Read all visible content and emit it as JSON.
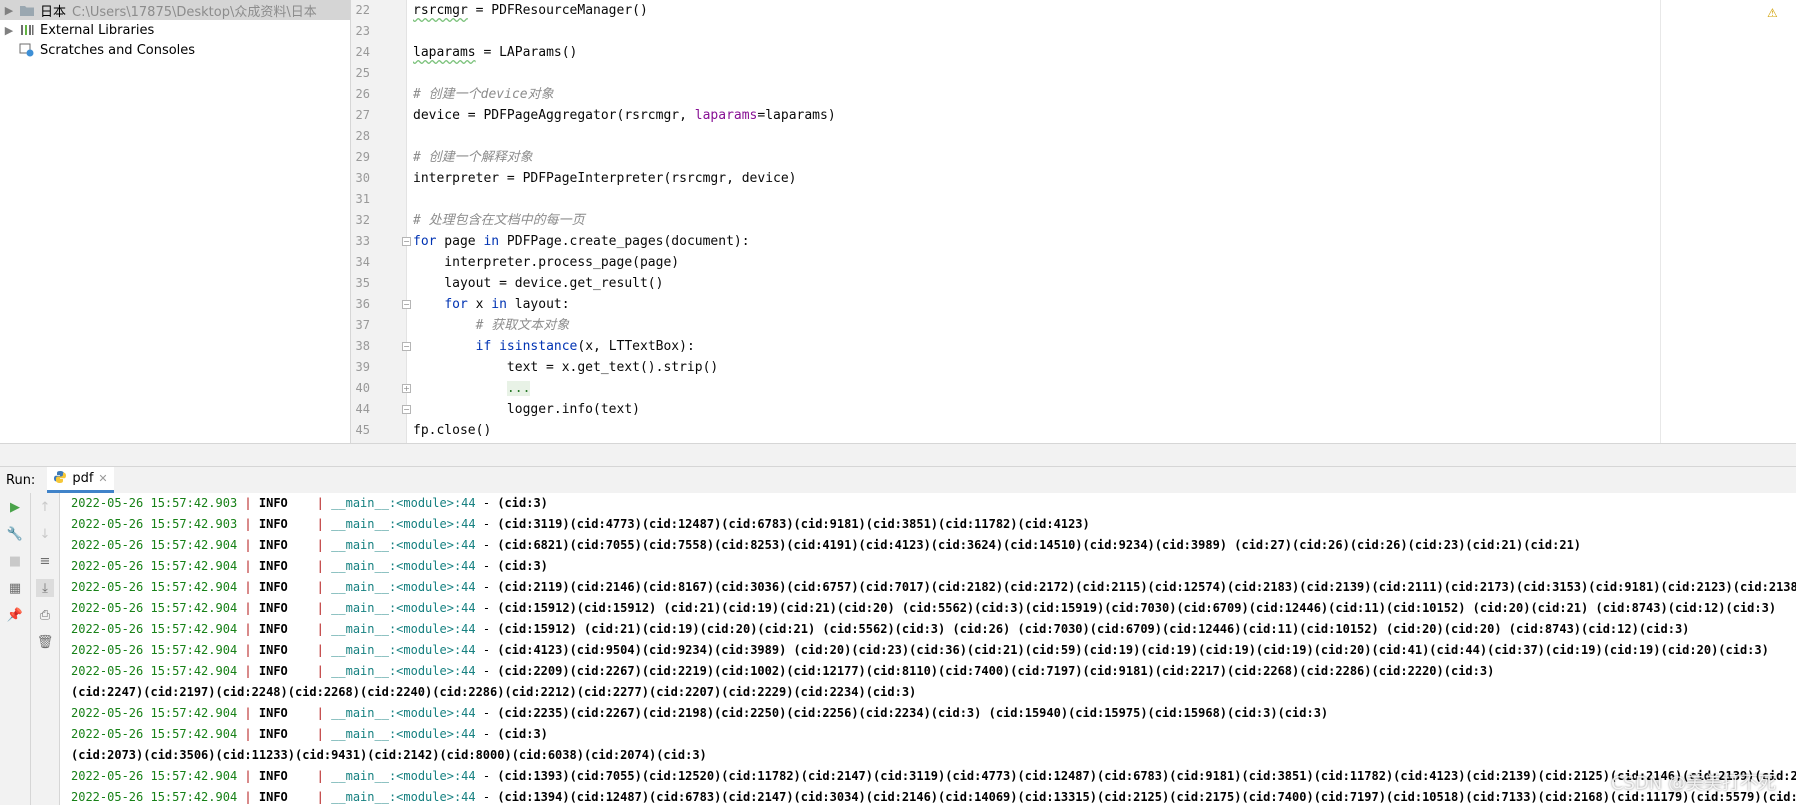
{
  "project_tree": [
    {
      "name": "日本",
      "path": "C:\\Users\\17875\\Desktop\\众成资料\\日本",
      "selected": true,
      "icon": "folder-icon"
    },
    {
      "name": "External Libraries",
      "path": "",
      "selected": false,
      "icon": "libraries-icon"
    },
    {
      "name": "Scratches and Consoles",
      "path": "",
      "selected": false,
      "icon": "scratches-icon"
    }
  ],
  "editor": {
    "line_numbers": [
      "22",
      "23",
      "24",
      "25",
      "26",
      "27",
      "28",
      "29",
      "30",
      "31",
      "32",
      "33",
      "34",
      "35",
      "36",
      "37",
      "38",
      "39",
      "40",
      "44",
      "45"
    ],
    "lines": [
      "rsrcmgr = PDFResourceManager()",
      "",
      "laparams = LAParams()",
      "",
      "# 创建一个device对象",
      "device = PDFPageAggregator(rsrcmgr, laparams=laparams)",
      "",
      "# 创建一个解释对象",
      "interpreter = PDFPageInterpreter(rsrcmgr, device)",
      "",
      "# 处理包含在文档中的每一页",
      "for page in PDFPage.create_pages(document):",
      "    interpreter.process_page(page)",
      "    layout = device.get_result()",
      "    for x in layout:",
      "        # 获取文本对象",
      "        if isinstance(x, LTTextBox):",
      "            text = x.get_text().strip()",
      "            ...",
      "            logger.info(text)",
      "fp.close()"
    ],
    "warning_icon": "warning-icon"
  },
  "run_panel": {
    "label": "Run:",
    "tab_name": "pdf",
    "toolbar": [
      "run-icon",
      "up-icon",
      "wrench-icon",
      "down-icon",
      "stop-icon",
      "soft-wrap-icon",
      "layout-icon",
      "scroll-end-icon",
      "pin-icon",
      "print-icon",
      "trash-icon"
    ]
  },
  "console": [
    {
      "ts": "2022-05-26 15:57:42.903",
      "level": "INFO",
      "module": "__main__:<module>:44",
      "msg": "(cid:3)"
    },
    {
      "ts": "2022-05-26 15:57:42.903",
      "level": "INFO",
      "module": "__main__:<module>:44",
      "msg": "(cid:3119)(cid:4773)(cid:12487)(cid:6783)(cid:9181)(cid:3851)(cid:11782)(cid:4123)"
    },
    {
      "ts": "2022-05-26 15:57:42.904",
      "level": "INFO",
      "module": "__main__:<module>:44",
      "msg": "(cid:6821)(cid:7055)(cid:7558)(cid:8253)(cid:4191)(cid:4123)(cid:3624)(cid:14510)(cid:9234)(cid:3989) (cid:27)(cid:26)(cid:26)(cid:23)(cid:21)(cid:21)"
    },
    {
      "ts": "2022-05-26 15:57:42.904",
      "level": "INFO",
      "module": "__main__:<module>:44",
      "msg": "(cid:3)"
    },
    {
      "ts": "2022-05-26 15:57:42.904",
      "level": "INFO",
      "module": "__main__:<module>:44",
      "msg": "(cid:2119)(cid:2146)(cid:8167)(cid:3036)(cid:6757)(cid:7017)(cid:2182)(cid:2172)(cid:2115)(cid:12574)(cid:2183)(cid:2139)(cid:2111)(cid:2173)(cid:3153)(cid:9181)(cid:2123)(cid:2138)(cid:2"
    },
    {
      "ts": "2022-05-26 15:57:42.904",
      "level": "INFO",
      "module": "__main__:<module>:44",
      "msg": "(cid:15912)(cid:15912) (cid:21)(cid:19)(cid:21)(cid:20) (cid:5562)(cid:3)(cid:15919)(cid:7030)(cid:6709)(cid:12446)(cid:11)(cid:10152) (cid:20)(cid:21) (cid:8743)(cid:12)(cid:3)"
    },
    {
      "ts": "2022-05-26 15:57:42.904",
      "level": "INFO",
      "module": "__main__:<module>:44",
      "msg": "(cid:15912) (cid:21)(cid:19)(cid:20)(cid:21) (cid:5562)(cid:3) (cid:26) (cid:7030)(cid:6709)(cid:12446)(cid:11)(cid:10152) (cid:20)(cid:20) (cid:8743)(cid:12)(cid:3)"
    },
    {
      "ts": "2022-05-26 15:57:42.904",
      "level": "INFO",
      "module": "__main__:<module>:44",
      "msg": "(cid:4123)(cid:9504)(cid:9234)(cid:3989) (cid:20)(cid:23)(cid:36)(cid:21)(cid:59)(cid:19)(cid:19)(cid:19)(cid:19)(cid:20)(cid:41)(cid:44)(cid:37)(cid:19)(cid:19)(cid:20)(cid:3)"
    },
    {
      "ts": "2022-05-26 15:57:42.904",
      "level": "INFO",
      "module": "__main__:<module>:44",
      "msg": "(cid:2209)(cid:2267)(cid:2219)(cid:1002)(cid:12177)(cid:8110)(cid:7400)(cid:7197)(cid:9181)(cid:2217)(cid:2268)(cid:2286)(cid:2220)(cid:3)"
    },
    {
      "raw": "(cid:2247)(cid:2197)(cid:2248)(cid:2268)(cid:2240)(cid:2286)(cid:2212)(cid:2277)(cid:2207)(cid:2229)(cid:2234)(cid:3)"
    },
    {
      "ts": "2022-05-26 15:57:42.904",
      "level": "INFO",
      "module": "__main__:<module>:44",
      "msg": "(cid:2235)(cid:2267)(cid:2198)(cid:2250)(cid:2256)(cid:2234)(cid:3) (cid:15940)(cid:15975)(cid:15968)(cid:3)(cid:3)"
    },
    {
      "ts": "2022-05-26 15:57:42.904",
      "level": "INFO",
      "module": "__main__:<module>:44",
      "msg": "(cid:3)"
    },
    {
      "raw": "(cid:2073)(cid:3506)(cid:11233)(cid:9431)(cid:2142)(cid:8000)(cid:6038)(cid:2074)(cid:3)"
    },
    {
      "ts": "2022-05-26 15:57:42.904",
      "level": "INFO",
      "module": "__main__:<module>:44",
      "msg": "(cid:1393)(cid:7055)(cid:12520)(cid:11782)(cid:2147)(cid:3119)(cid:4773)(cid:12487)(cid:6783)(cid:9181)(cid:3851)(cid:11782)(cid:4123)(cid:2139)(cid:2125)(cid:2146)(cid:2139)(cid:2058)(ci"
    },
    {
      "ts": "2022-05-26 15:57:42.904",
      "level": "INFO",
      "module": "__main__:<module>:44",
      "msg": "(cid:1394)(cid:12487)(cid:6783)(cid:2147)(cid:3034)(cid:2146)(cid:14069)(cid:13315)(cid:2125)(cid:2175)(cid:7400)(cid:7197)(cid:10518)(cid:7133)(cid:2168)(cid:11179)(cid:5579)(cid:9301)(ci"
    }
  ],
  "watermark": "CSDN @美美打不死"
}
